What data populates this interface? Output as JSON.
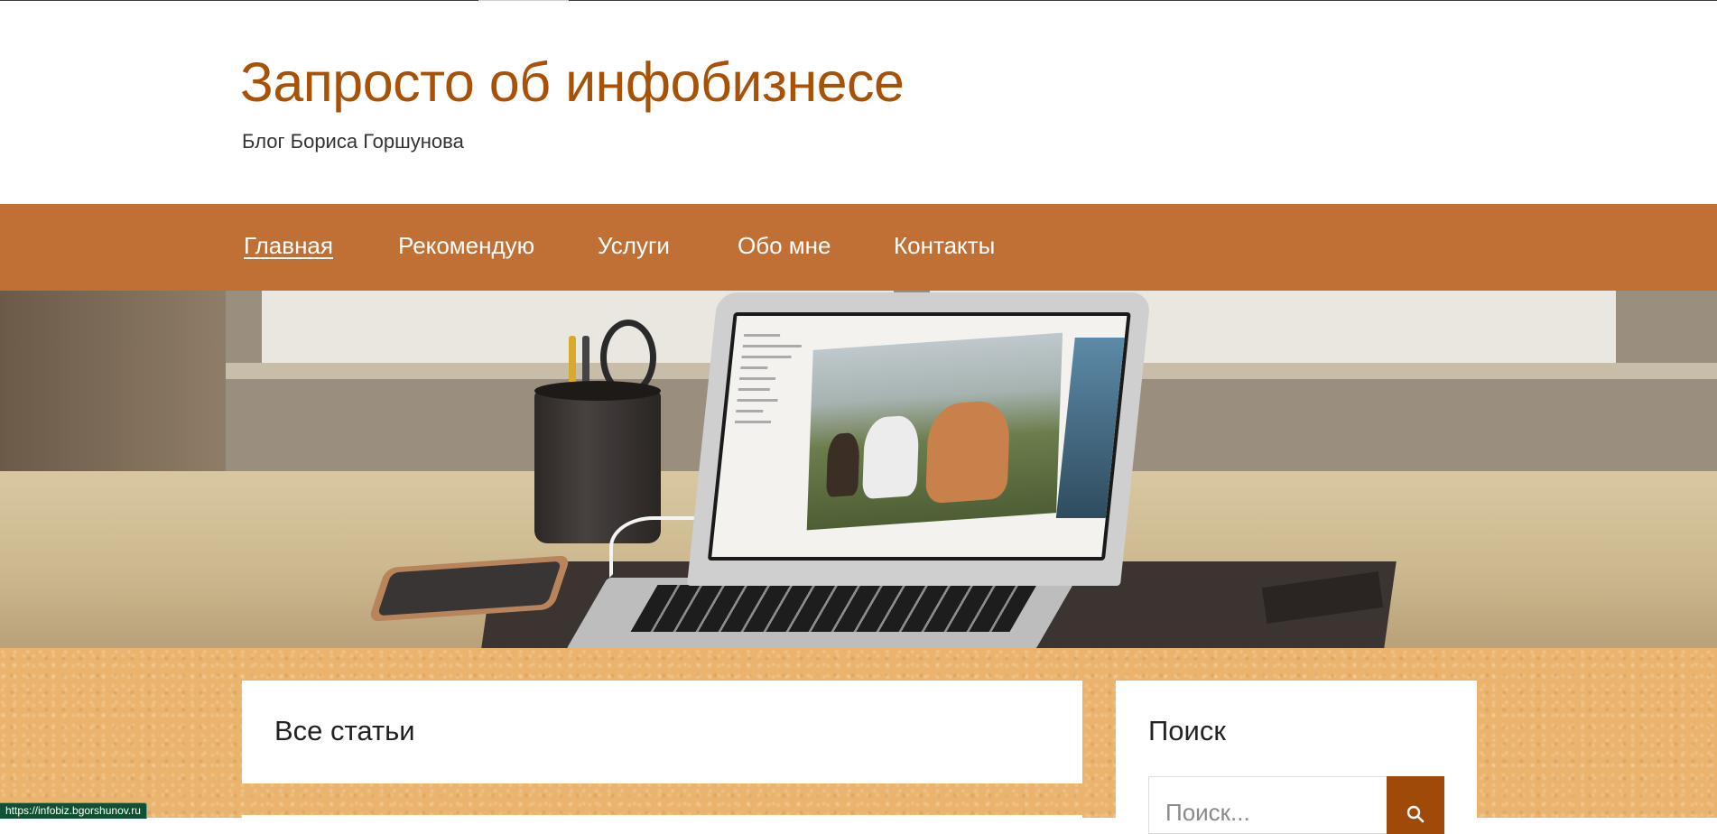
{
  "header": {
    "site_title": "Запросто об инфобизнесе",
    "tagline": "Блог Бориса Горшунова"
  },
  "nav": {
    "items": [
      {
        "label": "Главная",
        "active": true
      },
      {
        "label": "Рекомендую",
        "active": false
      },
      {
        "label": "Услуги",
        "active": false
      },
      {
        "label": "Обо мне",
        "active": false
      },
      {
        "label": "Контакты",
        "active": false
      }
    ]
  },
  "main": {
    "articles_title": "Все статьи"
  },
  "sidebar": {
    "search_title": "Поиск",
    "search_placeholder": "Поиск..."
  },
  "status_bar": {
    "url": "https://infobiz.bgorshunov.ru"
  },
  "colors": {
    "brand": "#a85208",
    "nav_background": "#c07034",
    "content_background": "#eab46e",
    "search_button": "#a04a0a"
  }
}
